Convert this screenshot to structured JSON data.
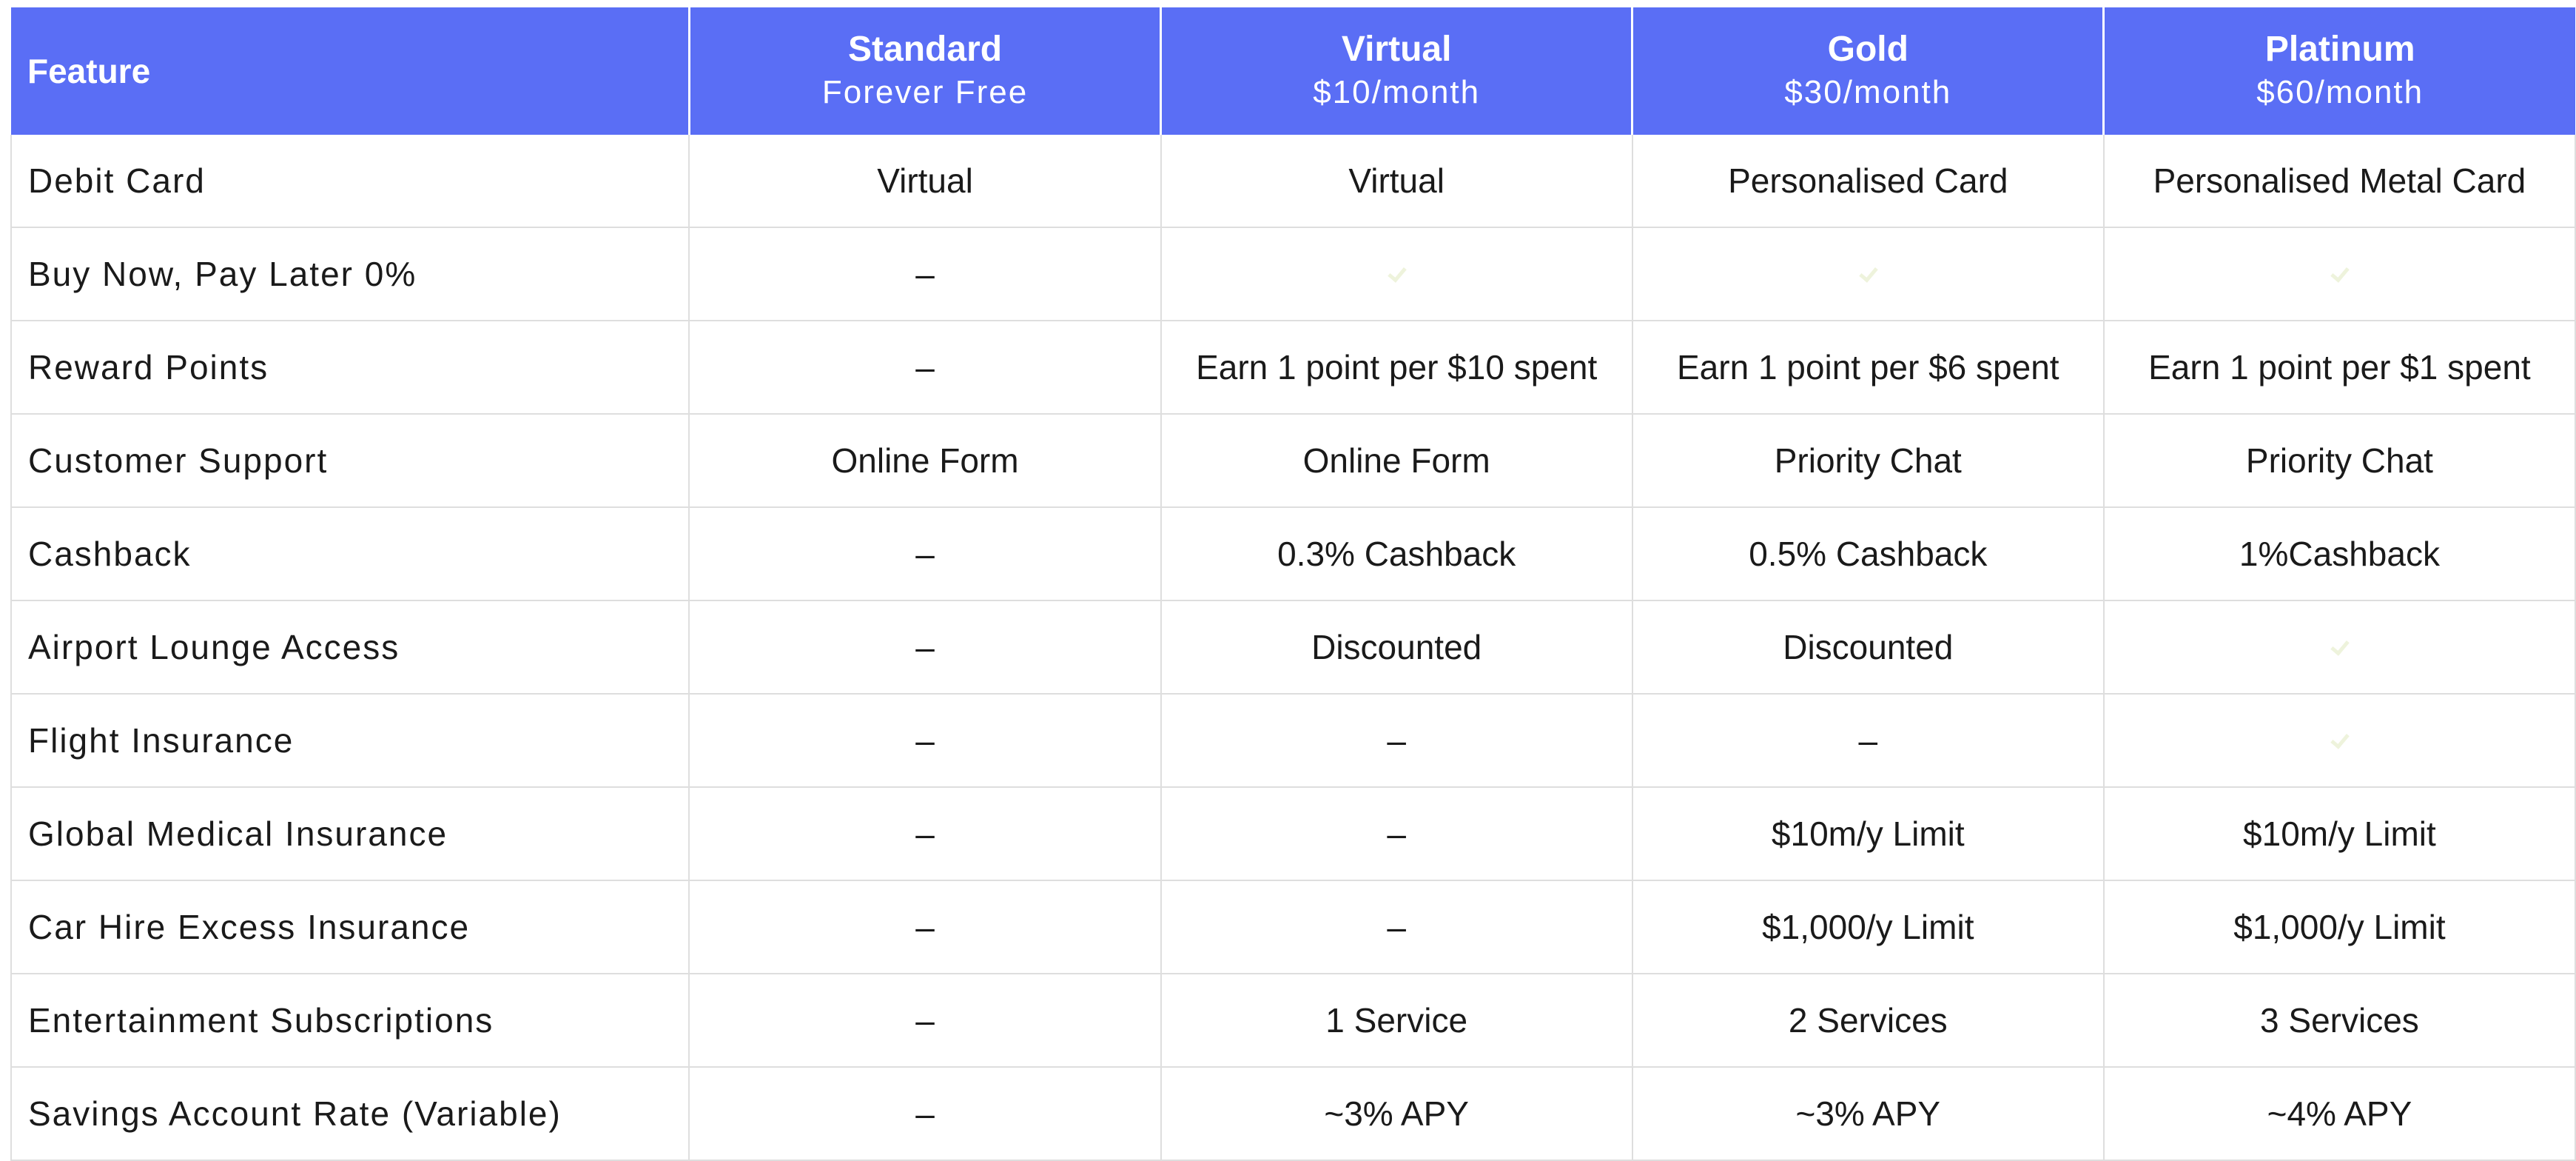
{
  "header": {
    "feature_label": "Feature",
    "plans": [
      {
        "name": "Standard",
        "price": "Forever Free"
      },
      {
        "name": "Virtual",
        "price": "$10/month"
      },
      {
        "name": "Gold",
        "price": "$30/month"
      },
      {
        "name": "Platinum",
        "price": "$60/month"
      }
    ]
  },
  "icons": {
    "included": "check-icon"
  },
  "colors": {
    "header_background": "#5a6ef5",
    "header_text": "#ffffff",
    "grid_line": "#dedede"
  },
  "rows": [
    {
      "feature": "Debit Card",
      "values": [
        "Virtual",
        "Virtual",
        "Personalised Card",
        "Personalised Metal Card"
      ]
    },
    {
      "feature": "Buy Now, Pay Later 0%",
      "values": [
        "–",
        "check-icon",
        "check-icon",
        "check-icon"
      ]
    },
    {
      "feature": "Reward Points",
      "values": [
        "–",
        "Earn 1 point per $10 spent",
        "Earn 1 point per $6 spent",
        "Earn 1 point per $1 spent"
      ]
    },
    {
      "feature": "Customer Support",
      "values": [
        "Online Form",
        "Online Form",
        "Priority Chat",
        "Priority Chat"
      ]
    },
    {
      "feature": "Cashback",
      "values": [
        "–",
        "0.3% Cashback",
        "0.5% Cashback",
        "1%Cashback"
      ]
    },
    {
      "feature": "Airport Lounge Access",
      "values": [
        "–",
        "Discounted",
        "Discounted",
        "check-icon"
      ]
    },
    {
      "feature": "Flight Insurance",
      "values": [
        "–",
        "–",
        "–",
        "check-icon"
      ]
    },
    {
      "feature": "Global Medical Insurance",
      "values": [
        "–",
        "–",
        "$10m/y Limit",
        "$10m/y Limit"
      ]
    },
    {
      "feature": "Car Hire Excess Insurance",
      "values": [
        "–",
        "–",
        "$1,000/y Limit",
        "$1,000/y Limit"
      ]
    },
    {
      "feature": "Entertainment Subscriptions",
      "values": [
        "–",
        "1 Service",
        "2 Services",
        "3 Services"
      ]
    },
    {
      "feature": "Savings Account Rate (Variable)",
      "values": [
        "–",
        "~3% APY",
        "~3% APY",
        "~4% APY"
      ]
    }
  ]
}
